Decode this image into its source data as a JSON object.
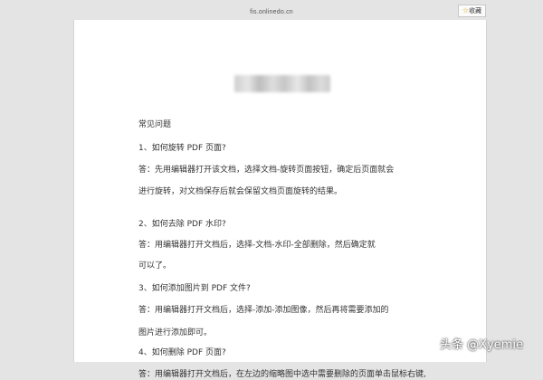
{
  "browser": {
    "url": "fis.onlinedo.cn",
    "favorite_label": "收藏"
  },
  "document": {
    "heading": "常见问题",
    "lines": [
      "1、如何旋转 PDF 页面?",
      "答：先用编辑器打开该文档，选择文档-旋转页面按钮，确定后页面就会",
      "进行旋转，对文档保存后就会保留文档页面旋转的结果。",
      "2、如何去除 PDF 水印?",
      "答：用编辑器打开文档后，选择-文档-水印-全部删除，然后确定就",
      "可以了。",
      "3、如何添加图片到 PDF 文件?",
      "答：用编辑器打开文档后，选择-添加-添加图像，然后再将需要添加的",
      "图片进行添加即可。",
      "4、如何删除 PDF 页面?",
      "答：用编辑器打开文档后，在左边的缩略图中选中需要删除的页面单击鼠标右键,"
    ]
  },
  "watermark": "头条 @Xyemie"
}
